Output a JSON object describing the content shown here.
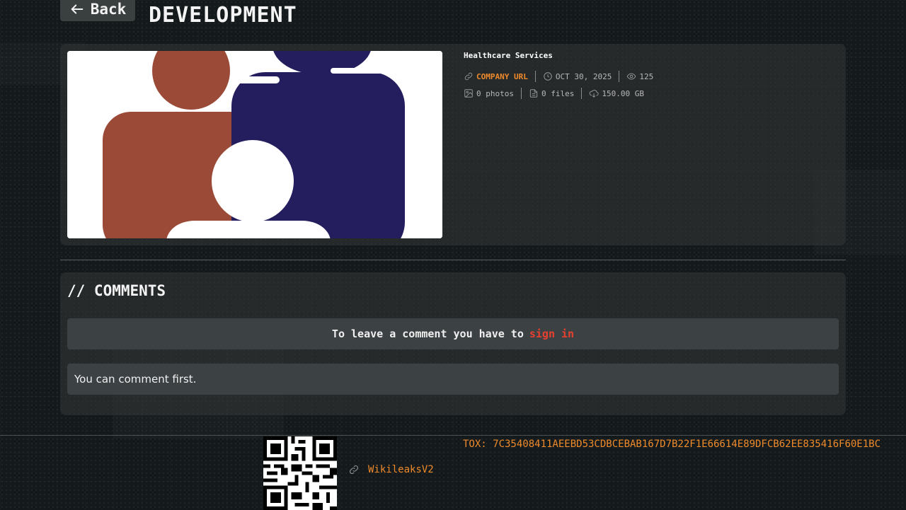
{
  "header": {
    "back_label": "Back",
    "title": "DEVELOPMENT"
  },
  "post": {
    "category": "Healthcare Services",
    "company_url_label": "COMPANY URL",
    "date": "OCT 30, 2025",
    "views": "125",
    "photos": "0 photos",
    "files": "0 files",
    "size": "150.00 GB",
    "image_colors": {
      "left_figure": "#9b4a38",
      "right_figure": "#241d5e",
      "child_figure": "#ffffff"
    }
  },
  "comments": {
    "title": "// COMMENTS",
    "signin_prompt": "To leave a comment you have to",
    "signin_link": "sign in",
    "empty_message": "You can comment first."
  },
  "footer": {
    "link_label": "WikileaksV2",
    "tox": "TOX: 7C35408411AEEBD53CDBCEBAB167D7B22F1E66614E89DFCB62EE835416F60E1BC"
  },
  "colors": {
    "accent": "#ef8a2b",
    "link_red": "#e8402f"
  }
}
